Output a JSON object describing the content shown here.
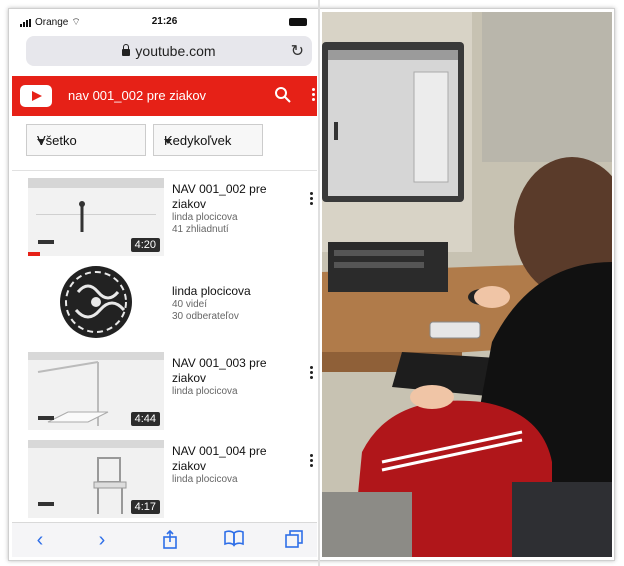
{
  "status": {
    "carrier": "Orange",
    "time": "21:26"
  },
  "browser": {
    "url": "youtube.com"
  },
  "youtube": {
    "channel_title": "nav 001_002 pre ziakov"
  },
  "filters": [
    {
      "label": "Všetko"
    },
    {
      "label": "Kedykoľvek"
    }
  ],
  "videos": [
    {
      "title_line1": "NAV 001_002 pre",
      "title_line2": "ziakov",
      "author": "linda plocicova",
      "views": "41 zhliadnutí",
      "duration": "4:20"
    },
    {
      "title_line1": "NAV 001_003 pre",
      "title_line2": "ziakov",
      "author": "linda plocicova",
      "views": "",
      "duration": "4:44"
    },
    {
      "title_line1": "NAV 001_004 pre",
      "title_line2": "ziakov",
      "author": "linda plocicova",
      "views": "",
      "duration": "4:17"
    }
  ],
  "channel": {
    "name": "linda plocicova",
    "videos": "40 videí",
    "subscribers": "30 odberateľov"
  },
  "colors": {
    "youtube_red": "#e62117",
    "ios_blue": "#2f6fe8"
  },
  "icons": {
    "back": "chevron-left-icon",
    "forward": "chevron-right-icon",
    "share": "share-icon",
    "bookmarks": "book-icon",
    "tabs": "tabs-icon"
  }
}
